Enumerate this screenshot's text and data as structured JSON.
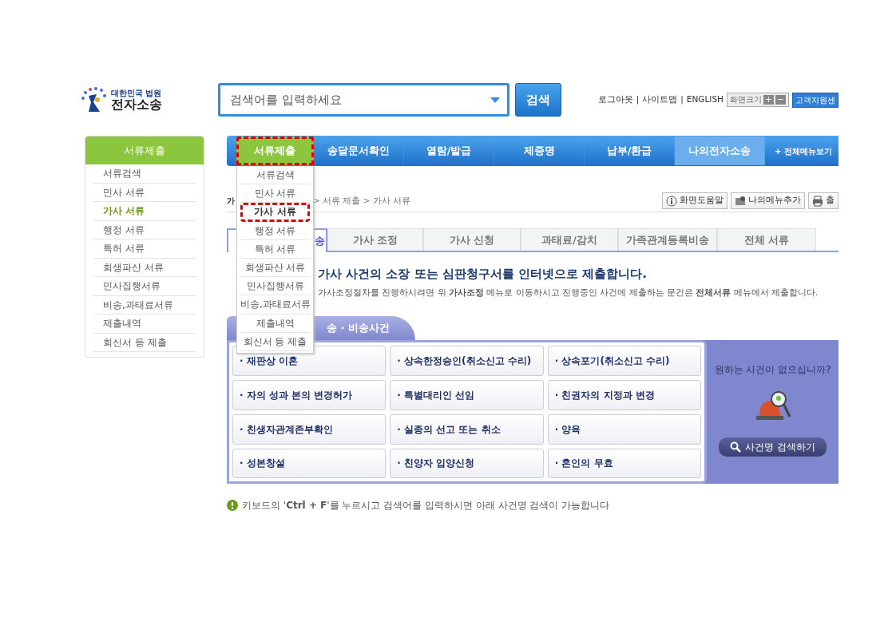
{
  "logo": {
    "line1": "대한민국 법원",
    "line2": "전자소송"
  },
  "search": {
    "placeholder": "검색어를 입력하세요",
    "button": "검색"
  },
  "top_links": [
    {
      "label": "로그아웃"
    },
    {
      "label": "사이트맵"
    },
    {
      "label": "ENGLISH"
    }
  ],
  "link_separator": "|",
  "zoom_control": {
    "label": "화면크기",
    "plus": "+",
    "minus": "−"
  },
  "support_button": "고객지원센",
  "sidebar": {
    "title": "서류제출",
    "items": [
      {
        "label": "서류검색",
        "selected": false
      },
      {
        "label": "민사 서류",
        "selected": false
      },
      {
        "label": "가사 서류",
        "selected": true
      },
      {
        "label": "행정 서류",
        "selected": false
      },
      {
        "label": "특허 서류",
        "selected": false
      },
      {
        "label": "회생파산 서류",
        "selected": false
      },
      {
        "label": "민사집행서류",
        "selected": false
      },
      {
        "label": "비송,과태료서류",
        "selected": false
      },
      {
        "label": "제출내역",
        "selected": false
      },
      {
        "label": "회신서 등 제출",
        "selected": false
      }
    ]
  },
  "nav": {
    "items": [
      {
        "label": "서류제출",
        "selected": true,
        "highlighted": true
      },
      {
        "label": "송달문서확인",
        "selected": false,
        "highlighted": false
      },
      {
        "label": "열람/발급",
        "selected": false,
        "highlighted": false
      },
      {
        "label": "제증명",
        "selected": false,
        "highlighted": false
      },
      {
        "label": "납부/환급",
        "selected": false,
        "highlighted": false
      },
      {
        "label": "나의전자소송",
        "selected": false,
        "highlighted": false
      }
    ],
    "all_menu": "+ 전체메뉴보기"
  },
  "dropdown": {
    "items": [
      {
        "label": "서류검색",
        "highlighted": false
      },
      {
        "label": "민사 서류",
        "highlighted": false
      },
      {
        "label": "가사 서류",
        "highlighted": true
      },
      {
        "label": "행정 서류",
        "highlighted": false
      },
      {
        "label": "특허 서류",
        "highlighted": false
      },
      {
        "label": "회생파산 서류",
        "highlighted": false
      },
      {
        "label": "민사집행서류",
        "highlighted": false
      },
      {
        "label": "비송,과태료서류",
        "highlighted": false
      },
      {
        "label": "제출내역",
        "highlighted": false
      },
      {
        "label": "회신서 등 제출",
        "highlighted": false
      }
    ]
  },
  "breadcrumb": {
    "lead": "가",
    "trail": "> 서류 제출 > 가사 서류"
  },
  "tool_buttons": [
    {
      "kind": "help",
      "label": "화면도움말"
    },
    {
      "kind": "bookmark",
      "label": "나의메뉴추가"
    },
    {
      "kind": "print",
      "label": "출"
    }
  ],
  "tabs": [
    {
      "label": "송",
      "selected": true
    },
    {
      "label": "가사 조정",
      "selected": false
    },
    {
      "label": "가사 신청",
      "selected": false
    },
    {
      "label": "과태료/감치",
      "selected": false
    },
    {
      "label": "가족관계등록비송",
      "selected": false
    },
    {
      "label": "전체 서류",
      "selected": false
    }
  ],
  "heading": "가사 사건의 **소장** 또는 **심판청구서**를 인터넷으로 제출합니다.",
  "subtext": [
    {
      "kind": "text",
      "text": "가사조정절차를 진행하시려면 위 "
    },
    {
      "kind": "link",
      "text": "가사조정"
    },
    {
      "kind": "text",
      "text": " 메뉴로 이동하시고 진행중인 사건에 제출하는 문건은 "
    },
    {
      "kind": "link",
      "text": "전체서류"
    },
    {
      "kind": "text",
      "text": " 메뉴에서 제출합니다."
    }
  ],
  "case_box": {
    "tab": "송 · 비송사건",
    "cases": [
      "· 재판상 이혼",
      "· 상속한정승인(취소신고 수리)",
      "· 상속포기(취소신고 수리)",
      "· 자의 성과 본의 변경허가",
      "· 특별대리인 선임",
      "· 친권자의 지정과 변경",
      "· 친생자관계존부확인",
      "· 실종의 선고 또는 취소",
      "· 양육",
      "· 성본창설",
      "· 친양자 입양신청",
      "· 혼인의 무효"
    ],
    "side": {
      "question": "원하는 사건이 없으십니까?",
      "button": "사건명 검색하기"
    }
  },
  "note": "키보드의 '**Ctrl + F**'를 누르시고 검색어를 입력하시면 아래 사건명 검색이 가능합니다"
}
